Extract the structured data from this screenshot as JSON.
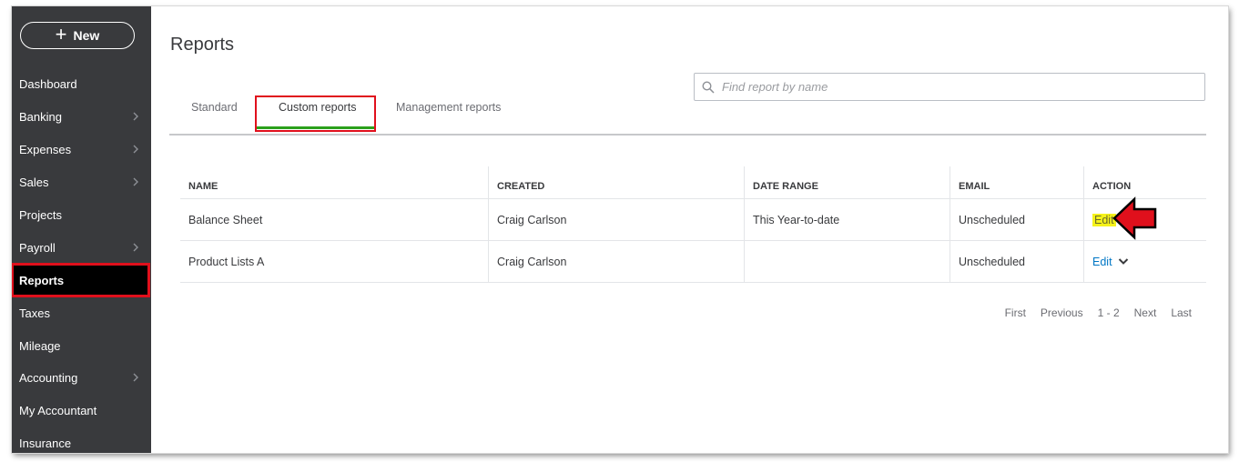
{
  "sidebar": {
    "new_label": "New",
    "items": [
      {
        "label": "Dashboard",
        "chevron": false
      },
      {
        "label": "Banking",
        "chevron": true
      },
      {
        "label": "Expenses",
        "chevron": true
      },
      {
        "label": "Sales",
        "chevron": true
      },
      {
        "label": "Projects",
        "chevron": false
      },
      {
        "label": "Payroll",
        "chevron": true
      },
      {
        "label": "Reports",
        "chevron": false,
        "active": true
      },
      {
        "label": "Taxes",
        "chevron": false
      },
      {
        "label": "Mileage",
        "chevron": false
      },
      {
        "label": "Accounting",
        "chevron": true
      },
      {
        "label": "My Accountant",
        "chevron": false
      },
      {
        "label": "Insurance",
        "chevron": false
      }
    ]
  },
  "header": {
    "title": "Reports",
    "search_placeholder": "Find report by name"
  },
  "tabs": [
    {
      "label": "Standard"
    },
    {
      "label": "Custom reports",
      "active": true
    },
    {
      "label": "Management reports"
    }
  ],
  "table": {
    "columns": [
      "NAME",
      "CREATED",
      "DATE RANGE",
      "EMAIL",
      "ACTION"
    ],
    "rows": [
      {
        "name": "Balance Sheet",
        "created": "Craig Carlson",
        "date_range": "This Year-to-date",
        "email": "Unscheduled",
        "action": "Edit"
      },
      {
        "name": "Product Lists A",
        "created": "Craig Carlson",
        "date_range": "",
        "email": "Unscheduled",
        "action": "Edit"
      }
    ]
  },
  "pagination": {
    "first": "First",
    "previous": "Previous",
    "range": "1 - 2",
    "next": "Next",
    "last": "Last"
  },
  "colors": {
    "sidebar_bg": "#393a3d",
    "highlight_red": "#e0101c",
    "tab_green": "#2ca01c",
    "link_blue": "#0077c5",
    "edit_highlight": "#f5f21a"
  }
}
